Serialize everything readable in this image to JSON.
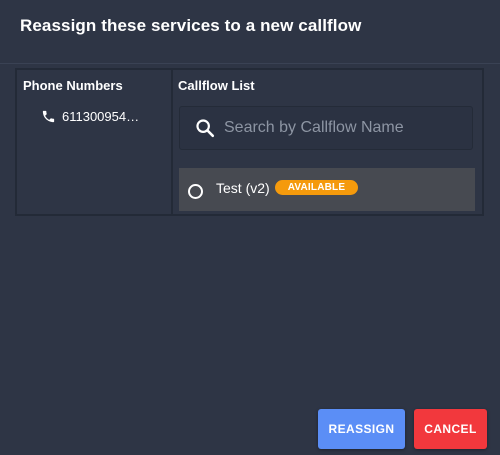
{
  "dialog": {
    "title": "Reassign these services to a new callflow"
  },
  "phone_numbers": {
    "header": "Phone Numbers",
    "items": [
      {
        "number": "611300954…",
        "icon": "phone-icon"
      }
    ]
  },
  "callflow_list": {
    "header": "Callflow List",
    "search": {
      "placeholder": "Search by Callflow Name",
      "value": "",
      "icon": "search-icon"
    },
    "items": [
      {
        "label": "Test (v2)",
        "badge": "AVAILABLE",
        "selected": false
      }
    ]
  },
  "actions": {
    "reassign_label": "REASSIGN",
    "cancel_label": "CANCEL"
  },
  "colors": {
    "background": "#2e3545",
    "reassign": "#5b8ef6",
    "cancel": "#f2383d",
    "badge": "#f59a0c",
    "selected_row": "#474a51"
  }
}
